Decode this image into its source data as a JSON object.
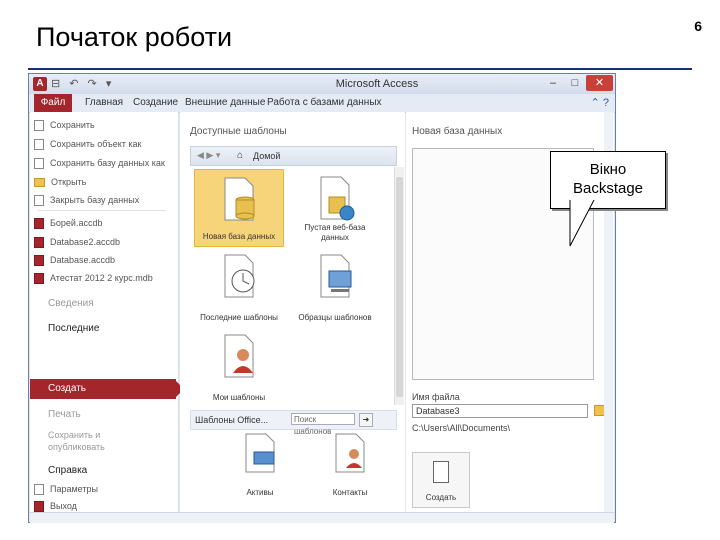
{
  "slide": {
    "title": "Початок роботи",
    "page_number": "6"
  },
  "window": {
    "title": "Microsoft Access",
    "qat": "⊟ ↶ ↷ ▾",
    "controls": {
      "minimize": "–",
      "maximize": "□",
      "close": "✕"
    }
  },
  "ribbon": {
    "tabs": [
      "Файл",
      "Главная",
      "Создание",
      "Внешние данные",
      "Работа с базами данных"
    ],
    "help": "⌃ ?"
  },
  "left_panel": {
    "file_items": [
      "Сохранить",
      "Сохранить объект как",
      "Сохранить базу данных как",
      "Открыть",
      "Закрыть базу данных"
    ],
    "recent_files": [
      "Борей.accdb",
      "Database2.accdb",
      "Database.accdb",
      "Атестат 2012 2 курс.mdb"
    ],
    "sections": {
      "info": "Сведения",
      "recent": "Последние",
      "create": "Создать",
      "print": "Печать",
      "save_publish": "Сохранить и опубликовать",
      "help": "Справка",
      "options": "Параметры",
      "exit": "Выход"
    }
  },
  "templates": {
    "heading": "Доступные шаблоны",
    "nav_home": "Домой",
    "items": [
      "Новая база данных",
      "Пустая веб-база данных",
      "Последние шаблоны",
      "Образцы шаблонов",
      "Мои шаблоны"
    ],
    "office_section": "Шаблоны Office...",
    "search_placeholder": "Поиск шаблонов",
    "office_items": [
      "Активы",
      "Контакты"
    ]
  },
  "right_panel": {
    "heading": "Новая база данных",
    "filename_label": "Имя файла",
    "filename_value": "Database3",
    "path": "C:\\Users\\All\\Documents\\",
    "create_button": "Создать"
  },
  "callout": {
    "line1": "Вікно",
    "line2": "Backstage"
  },
  "colors": {
    "accent": "#a4262c",
    "title_rule": "#1a2d7a",
    "selected_tile": "#f6d57a"
  }
}
